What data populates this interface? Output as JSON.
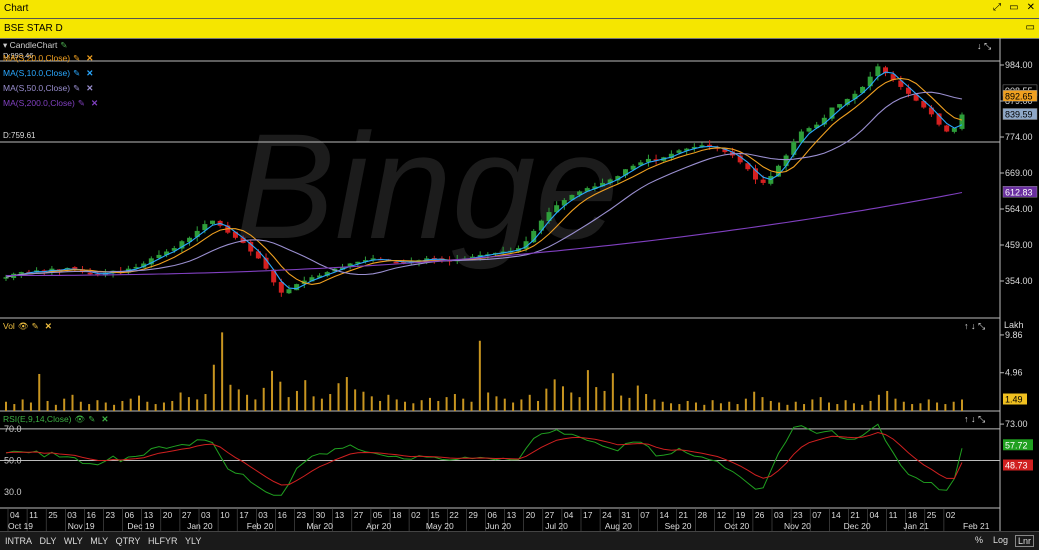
{
  "window": {
    "title": "Chart"
  },
  "symbol_bar": {
    "title": "BSE STAR D"
  },
  "price_pane": {
    "legend": [
      {
        "label": "CandleChart",
        "color": "#cfcfcf"
      },
      {
        "label": "MA(S,20.0,Close)",
        "color": "#f0a020",
        "value": "D:998.46"
      },
      {
        "label": "MA(S,10.0,Close)",
        "color": "#2aa8ff"
      },
      {
        "label": "MA(S,50.0,Close)",
        "color": "#9a8fd0"
      },
      {
        "label": "MA(S,200.0,Close)",
        "color": "#8040c0"
      }
    ],
    "low_label": "D:759.61",
    "ticks": [
      "984.00",
      "879.00",
      "774.00",
      "669.00",
      "564.00",
      "459.00",
      "354.00"
    ],
    "badges": [
      {
        "text": "908.55",
        "color": "#e0e0e0",
        "bg": "#000"
      },
      {
        "text": "892.65",
        "color": "#000",
        "bg": "#f0a020"
      },
      {
        "text": "839.59",
        "color": "#000",
        "bg": "#8fa8c8"
      },
      {
        "text": "612.83",
        "color": "#fff",
        "bg": "#6a2fa0"
      }
    ]
  },
  "volume_pane": {
    "title": "Vol",
    "unit": "Lakh",
    "ticks": [
      "9.86",
      "4.96"
    ],
    "badge": "1.49"
  },
  "rsi_pane": {
    "title": "RSI(E,9,14,Close)",
    "left_labels": [
      "70.0",
      "50.0",
      "30.0"
    ],
    "ticks": [
      "73.00"
    ],
    "badges": [
      {
        "text": "57.72",
        "bg": "#20a020"
      },
      {
        "text": "48.73",
        "bg": "#d02020"
      }
    ]
  },
  "x_axis": {
    "days": [
      "04",
      "11",
      "25",
      "03",
      "16",
      "23",
      "06",
      "13",
      "20",
      "27",
      "03",
      "10",
      "17",
      "03",
      "16",
      "23",
      "30",
      "13",
      "27",
      "05",
      "18",
      "02",
      "15",
      "22",
      "29",
      "06",
      "13",
      "20",
      "27",
      "04",
      "17",
      "24",
      "31",
      "07",
      "14",
      "21",
      "28",
      "12",
      "19",
      "26",
      "03",
      "23",
      "07",
      "14",
      "21",
      "04",
      "11",
      "18",
      "25",
      "02"
    ],
    "months": [
      "Oct 19",
      "Nov 19",
      "Dec 19",
      "Jan 20",
      "Feb 20",
      "Mar 20",
      "Apr 20",
      "May 20",
      "Jun 20",
      "Jul 20",
      "Aug 20",
      "Sep 20",
      "Oct 20",
      "Nov 20",
      "Dec 20",
      "Jan 21",
      "Feb 21"
    ]
  },
  "timeframes": [
    "INTRA",
    "DLY",
    "WLY",
    "MLY",
    "QTRY",
    "HLFYR",
    "YLY"
  ],
  "right_controls": {
    "percent": "%",
    "log": "Log",
    "linear": "Lnr"
  },
  "watermark": "Binge",
  "chart_data": {
    "type": "candlestick",
    "x_range": [
      "Oct 19",
      "Feb 21"
    ],
    "ylim": [
      354,
      984
    ],
    "close_approx": [
      365,
      375,
      380,
      378,
      385,
      380,
      390,
      385,
      392,
      388,
      380,
      376,
      372,
      378,
      384,
      380,
      390,
      395,
      405,
      420,
      430,
      440,
      450,
      470,
      480,
      500,
      520,
      530,
      515,
      495,
      480,
      465,
      440,
      420,
      390,
      350,
      320,
      330,
      345,
      355,
      365,
      370,
      380,
      390,
      395,
      405,
      410,
      415,
      420,
      415,
      412,
      410,
      408,
      410,
      415,
      420,
      418,
      414,
      412,
      416,
      420,
      425,
      430,
      432,
      436,
      440,
      442,
      450,
      470,
      500,
      530,
      555,
      575,
      590,
      605,
      615,
      625,
      630,
      640,
      650,
      660,
      680,
      690,
      700,
      710,
      705,
      715,
      725,
      735,
      740,
      745,
      750,
      745,
      740,
      730,
      720,
      700,
      680,
      650,
      640,
      660,
      690,
      720,
      760,
      790,
      800,
      810,
      830,
      860,
      870,
      885,
      900,
      920,
      950,
      980,
      960,
      940,
      920,
      900,
      880,
      860,
      840,
      810,
      790,
      800,
      839.59
    ],
    "series": [
      {
        "name": "MA(S,20.0,Close)",
        "last": 892.65
      },
      {
        "name": "MA(S,10.0,Close)",
        "last": 908.55
      },
      {
        "name": "MA(S,50.0,Close)",
        "last": 839.59
      },
      {
        "name": "MA(S,200.0,Close)",
        "last": 612.83
      }
    ],
    "volume": [
      1.2,
      0.9,
      1.5,
      1.1,
      4.8,
      1.3,
      0.8,
      1.6,
      2.1,
      1.2,
      0.9,
      1.4,
      1.1,
      0.8,
      1.3,
      1.6,
      2.0,
      1.2,
      0.9,
      1.1,
      1.3,
      2.4,
      1.8,
      1.5,
      2.2,
      6.0,
      10.2,
      3.4,
      2.8,
      2.1,
      1.5,
      3.0,
      5.2,
      3.8,
      1.8,
      2.6,
      4.0,
      1.9,
      1.6,
      2.2,
      3.6,
      4.4,
      2.8,
      2.5,
      1.9,
      1.3,
      2.1,
      1.5,
      1.2,
      1.0,
      1.4,
      1.7,
      1.3,
      1.8,
      2.2,
      1.6,
      1.2,
      9.1,
      2.4,
      1.9,
      1.6,
      1.1,
      1.5,
      2.1,
      1.3,
      2.9,
      4.1,
      3.2,
      2.4,
      1.8,
      5.3,
      3.1,
      2.6,
      4.9,
      2.0,
      1.7,
      3.3,
      2.2,
      1.5,
      1.2,
      1.0,
      0.9,
      1.3,
      1.1,
      0.8,
      1.4,
      1.0,
      1.2,
      0.9,
      1.6,
      2.5,
      1.8,
      1.3,
      1.1,
      0.8,
      1.2,
      0.9,
      1.5,
      1.8,
      1.1,
      0.9,
      1.4,
      1.0,
      0.8,
      1.3,
      2.1,
      2.6,
      1.6,
      1.2,
      0.9,
      1.0,
      1.5,
      1.1,
      0.9,
      1.2,
      1.49
    ],
    "rsi_level_lines": [
      70,
      50,
      30
    ],
    "rsi_last": 57.72,
    "rsi_signal_last": 48.73
  }
}
